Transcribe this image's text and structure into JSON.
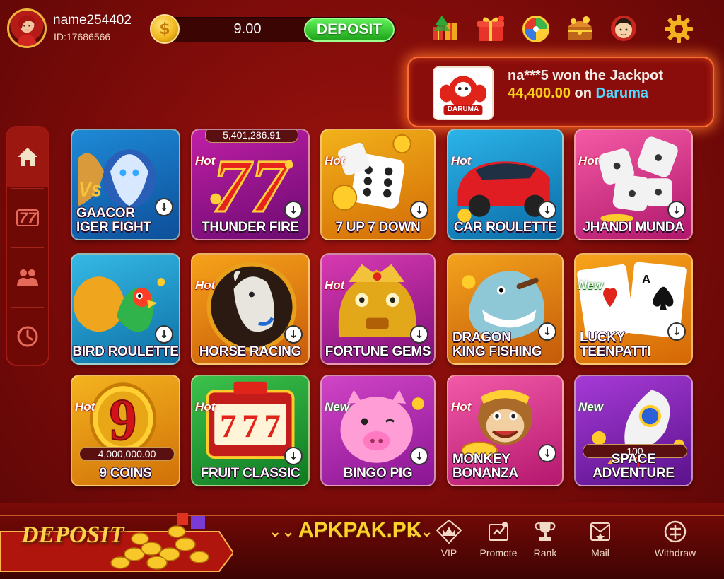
{
  "user": {
    "name": "name254402",
    "id": "ID:17686566"
  },
  "balance": {
    "value": "9.00",
    "deposit_label": "DEPOSIT"
  },
  "top_icons": [
    "gift-tree-icon",
    "gift-box-icon",
    "lucky-wheel-icon",
    "treasure-chest-icon",
    "customer-service-icon",
    "settings-gear-icon"
  ],
  "jackpot": {
    "thumb_label": "DARUMA",
    "text_before": "na***5 won the Jackpot",
    "amount": "44,400.00",
    "text_on": "on",
    "game": "Daruma"
  },
  "sidebar": {
    "items": [
      {
        "name": "home",
        "icon": "home-icon",
        "active": true
      },
      {
        "name": "slots",
        "icon": "slot-777-icon"
      },
      {
        "name": "multiplayer",
        "icon": "players-icon"
      },
      {
        "name": "history",
        "icon": "history-clock-icon"
      }
    ]
  },
  "games": [
    {
      "name": "GAACOR\nIGER FIGHT",
      "badge": "",
      "bg": [
        "#1e8ad6",
        "#0d4f9a"
      ]
    },
    {
      "name": "THUNDER FIRE",
      "badge": "Hot",
      "counter": "5,401,286.91",
      "bg": [
        "#c01fa6",
        "#6a0a70"
      ]
    },
    {
      "name": "7 UP 7 DOWN",
      "badge": "Hot",
      "bg": [
        "#f2b21a",
        "#d26a06"
      ]
    },
    {
      "name": "CAR ROULETTE",
      "badge": "Hot",
      "bg": [
        "#2bb4e8",
        "#0b6aa6"
      ]
    },
    {
      "name": "JHANDI MUNDA",
      "badge": "Hot",
      "bg": [
        "#f45aa4",
        "#b0176c"
      ]
    },
    {
      "name": "BIRD ROULETTE",
      "badge": "",
      "bg": [
        "#35b9e5",
        "#0d6fa6"
      ]
    },
    {
      "name": "HORSE RACING",
      "badge": "Hot",
      "bg": [
        "#f6a31a",
        "#c85a0a"
      ]
    },
    {
      "name": "FORTUNE GEMS",
      "badge": "Hot",
      "bg": [
        "#d83ab2",
        "#7e0f7a"
      ]
    },
    {
      "name": "DRAGON\nKING FISHING",
      "badge": "",
      "bg": [
        "#f3a21c",
        "#c45a0a"
      ]
    },
    {
      "name": "LUCKY\nTEENPATTI",
      "badge": "New",
      "bg": [
        "#f7a31b",
        "#d56806"
      ]
    },
    {
      "name": "9 COINS",
      "badge": "Hot",
      "counter": "4,000,000.00",
      "bg": [
        "#f4b31e",
        "#d07008"
      ]
    },
    {
      "name": "FRUIT CLASSIC",
      "badge": "Hot",
      "bg": [
        "#3cc24c",
        "#0f7a22"
      ]
    },
    {
      "name": "BINGO PIG",
      "badge": "New",
      "bg": [
        "#d045c6",
        "#8a1594"
      ]
    },
    {
      "name": "MONKEY\nBONANZA",
      "badge": "Hot",
      "bg": [
        "#f25aa8",
        "#b4176e"
      ]
    },
    {
      "name": "SPACE\nADVENTURE",
      "badge": "New",
      "counter": "100",
      "bg": [
        "#a63ad6",
        "#5a128c"
      ]
    }
  ],
  "bottom": {
    "deposit_label": "DEPOSIT",
    "brand": "APKPAK.PK",
    "nav": [
      {
        "label": "VIP",
        "icon": "vip-crown-icon"
      },
      {
        "label": "Promote",
        "icon": "promote-icon"
      },
      {
        "label": "Rank",
        "icon": "rank-trophy-icon"
      },
      {
        "label": "Mail",
        "icon": "mail-icon"
      },
      {
        "label": "Withdraw",
        "icon": "withdraw-icon"
      }
    ]
  }
}
